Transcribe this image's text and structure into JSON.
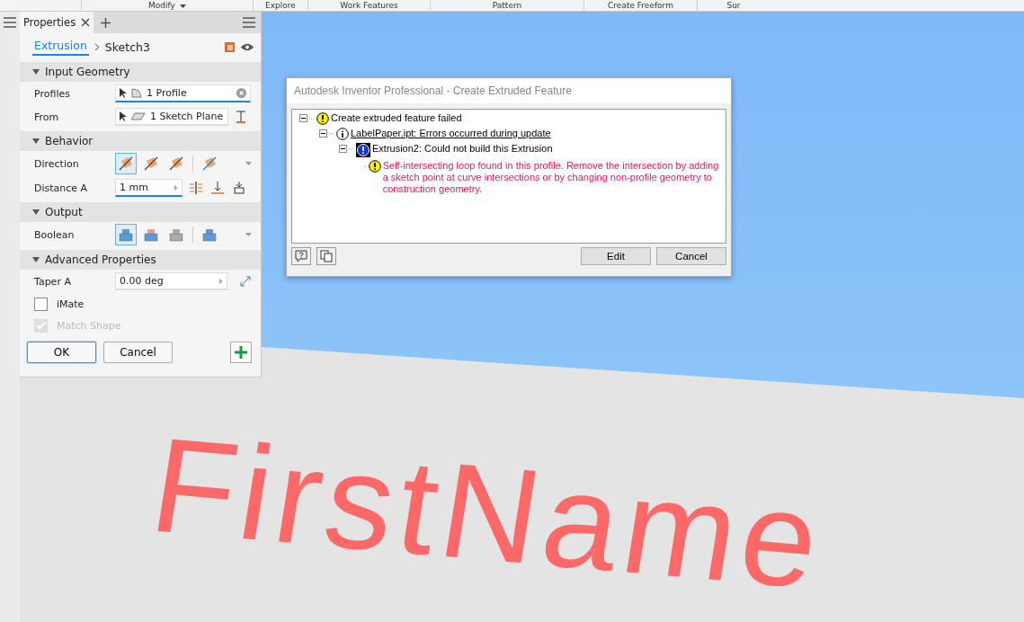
{
  "ribbon": [
    {
      "label": "Modify",
      "dropdown": true
    },
    {
      "label": "Explore",
      "dropdown": false
    },
    {
      "label": "Work Features",
      "dropdown": false
    },
    {
      "label": "Pattern",
      "dropdown": false
    },
    {
      "label": "Create Freeform",
      "dropdown": false
    },
    {
      "label": "Sur",
      "dropdown": false
    }
  ],
  "panel": {
    "tab": "Properties",
    "breadcrumb": {
      "feature": "Extrusion",
      "sketch": "Sketch3"
    },
    "sections": [
      {
        "title": "Input Geometry",
        "expanded": true,
        "rows": [
          {
            "kind": "select",
            "label": "Profiles",
            "value": "1 Profile",
            "active": true
          },
          {
            "kind": "select",
            "label": "From",
            "value": "1 Sketch Plane",
            "active": false
          }
        ]
      },
      {
        "title": "Behavior",
        "expanded": true,
        "rows": [
          {
            "kind": "toggles",
            "label": "Direction",
            "options": [
              {
                "selected": true
              },
              {
                "selected": false
              },
              {
                "selected": false
              },
              {
                "selected": false
              }
            ]
          },
          {
            "kind": "number",
            "label": "Distance A",
            "value": "1 mm",
            "active": true
          }
        ]
      },
      {
        "title": "Output",
        "expanded": true,
        "rows": [
          {
            "kind": "toggles",
            "label": "Boolean",
            "options": [
              {
                "selected": true
              },
              {
                "selected": false
              },
              {
                "selected": false
              },
              {
                "selected": false
              }
            ]
          }
        ]
      },
      {
        "title": "Advanced Properties",
        "expanded": true,
        "rows": [
          {
            "kind": "number",
            "label": "Taper A",
            "value": "0.00 deg",
            "active": false
          },
          {
            "kind": "check",
            "label": "iMate",
            "checked": false,
            "disabled": false
          },
          {
            "kind": "check",
            "label": "Match Shape",
            "checked": true,
            "disabled": true
          }
        ]
      }
    ],
    "buttons": [
      "OK",
      "Cancel"
    ]
  },
  "viewport": {
    "text": "FirstName"
  },
  "dialog": {
    "title": "Autodesk Inventor Professional - Create Extruded Feature",
    "tree": [
      {
        "kind": "warning",
        "text": "Create extruded feature failed",
        "link": false,
        "children": [
          {
            "kind": "info",
            "text": "LabelPaper.ipt: Errors occurred during update",
            "link": true,
            "children": [
              {
                "kind": "error",
                "text": "Extrusion2: Could not build this Extrusion",
                "link": false,
                "children": [
                  {
                    "kind": "warning",
                    "text": "Self-intersecting loop found in this profile.  Remove the intersection by adding a sketch point at curve intersections or by changing non-profile geometry to construction geometry.",
                    "link": false,
                    "message": true
                  }
                ]
              }
            ]
          }
        ]
      }
    ],
    "buttons": [
      "Edit",
      "Cancel"
    ]
  }
}
